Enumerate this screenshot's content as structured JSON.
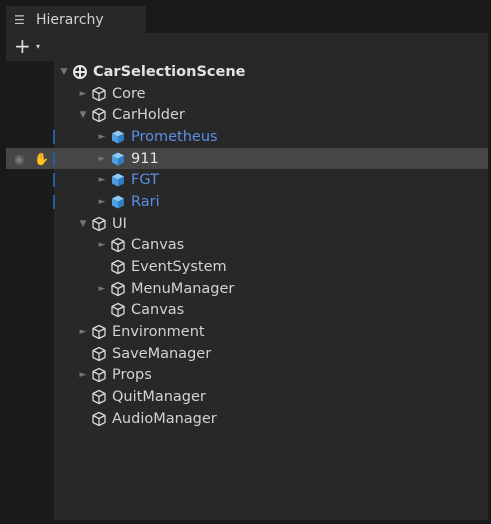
{
  "tab": {
    "title": "Hierarchy",
    "icon": "list-icon"
  },
  "toolbar": {
    "add_label": "+",
    "caret": "▾"
  },
  "tree": [
    {
      "label": "CarSelectionScene",
      "depth": 0,
      "arrow": "▼",
      "type": "scene"
    },
    {
      "label": "Core",
      "depth": 1,
      "arrow": "►",
      "type": "object"
    },
    {
      "label": "CarHolder",
      "depth": 1,
      "arrow": "▼",
      "type": "object"
    },
    {
      "label": "Prometheus",
      "depth": 2,
      "arrow": "►",
      "type": "prefab",
      "marker": true
    },
    {
      "label": "911",
      "depth": 2,
      "arrow": "►",
      "type": "prefab-active",
      "marker": true,
      "highlight": true
    },
    {
      "label": "FGT",
      "depth": 2,
      "arrow": "►",
      "type": "prefab",
      "marker": true
    },
    {
      "label": "Rari",
      "depth": 2,
      "arrow": "►",
      "type": "prefab",
      "marker": true
    },
    {
      "label": "UI",
      "depth": 1,
      "arrow": "▼",
      "type": "object"
    },
    {
      "label": "Canvas",
      "depth": 2,
      "arrow": "►",
      "type": "object"
    },
    {
      "label": "EventSystem",
      "depth": 2,
      "arrow": "",
      "type": "object"
    },
    {
      "label": "MenuManager",
      "depth": 2,
      "arrow": "►",
      "type": "object"
    },
    {
      "label": "Canvas",
      "depth": 2,
      "arrow": "",
      "type": "object"
    },
    {
      "label": "Environment",
      "depth": 1,
      "arrow": "►",
      "type": "object"
    },
    {
      "label": "SaveManager",
      "depth": 1,
      "arrow": "",
      "type": "object"
    },
    {
      "label": "Props",
      "depth": 1,
      "arrow": "►",
      "type": "object"
    },
    {
      "label": "QuitManager",
      "depth": 1,
      "arrow": "",
      "type": "object"
    },
    {
      "label": "AudioManager",
      "depth": 1,
      "arrow": "",
      "type": "object"
    }
  ],
  "colors": {
    "panel_bg": "#282828",
    "highlight_row": "#464646",
    "prefab_blue": "#5b8ee6",
    "prefab_cube": "#5fa8e8",
    "text": "#d2d2d2"
  }
}
